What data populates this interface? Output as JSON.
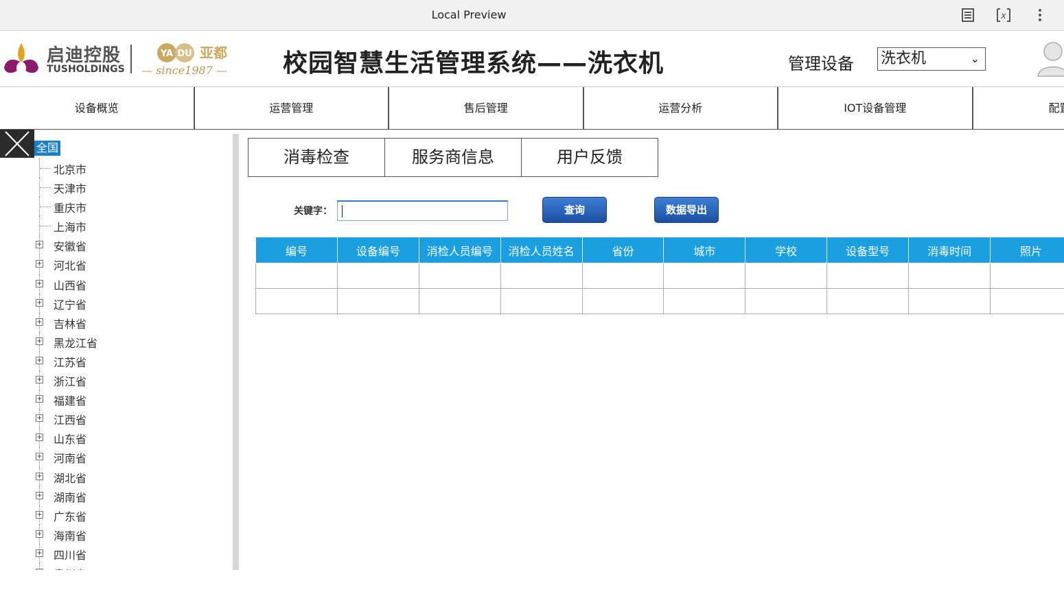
{
  "browser": {
    "title": "Local Preview",
    "icons": [
      "reader-icon",
      "formula-icon",
      "more-icon"
    ]
  },
  "header": {
    "brand_cn": "启迪控股",
    "brand_en": "TUSHOLDINGS",
    "yadu_ya": "YA",
    "yadu_du": "DU",
    "yadu_cn": "亚都",
    "yadu_since": "— since1987 —",
    "system_title": "校园智慧生活管理系统——洗衣机",
    "device_label": "管理设备",
    "device_selected": "洗衣机"
  },
  "nav": {
    "items": [
      "设备概览",
      "运营管理",
      "售后管理",
      "运营分析",
      "IOT设备管理",
      "配置"
    ]
  },
  "tree": {
    "root": "全国",
    "items": [
      {
        "label": "北京市",
        "expandable": false
      },
      {
        "label": "天津市",
        "expandable": false
      },
      {
        "label": "重庆市",
        "expandable": false
      },
      {
        "label": "上海市",
        "expandable": false
      },
      {
        "label": "安徽省",
        "expandable": true
      },
      {
        "label": "河北省",
        "expandable": true
      },
      {
        "label": "山西省",
        "expandable": true
      },
      {
        "label": "辽宁省",
        "expandable": true
      },
      {
        "label": "吉林省",
        "expandable": true
      },
      {
        "label": "黑龙江省",
        "expandable": true
      },
      {
        "label": "江苏省",
        "expandable": true
      },
      {
        "label": "浙江省",
        "expandable": true
      },
      {
        "label": "福建省",
        "expandable": true
      },
      {
        "label": "江西省",
        "expandable": true
      },
      {
        "label": "山东省",
        "expandable": true
      },
      {
        "label": "河南省",
        "expandable": true
      },
      {
        "label": "湖北省",
        "expandable": true
      },
      {
        "label": "湖南省",
        "expandable": true
      },
      {
        "label": "广东省",
        "expandable": true
      },
      {
        "label": "海南省",
        "expandable": true
      },
      {
        "label": "四川省",
        "expandable": true
      },
      {
        "label": "贵州省",
        "expandable": true
      }
    ]
  },
  "tabs": [
    "消毒检查",
    "服务商信息",
    "用户反馈"
  ],
  "search": {
    "keyword_label": "关键字：",
    "value": "",
    "query_button": "查询",
    "export_button": "数据导出"
  },
  "table": {
    "headers": [
      "编号",
      "设备编号",
      "消检人员编号",
      "消检人员姓名",
      "省份",
      "城市",
      "学校",
      "设备型号",
      "消毒时间",
      "照片"
    ],
    "rows": [
      [
        "",
        "",
        "",
        "",
        "",
        "",
        "",
        "",
        "",
        ""
      ],
      [
        "",
        "",
        "",
        "",
        "",
        "",
        "",
        "",
        "",
        ""
      ]
    ]
  },
  "colors": {
    "table_header": "#1a9fe0",
    "tree_selected": "#1a7fc9",
    "button": "#2a64bd",
    "gold": "#b8964a",
    "tus_purple": "#8b1a6b"
  }
}
